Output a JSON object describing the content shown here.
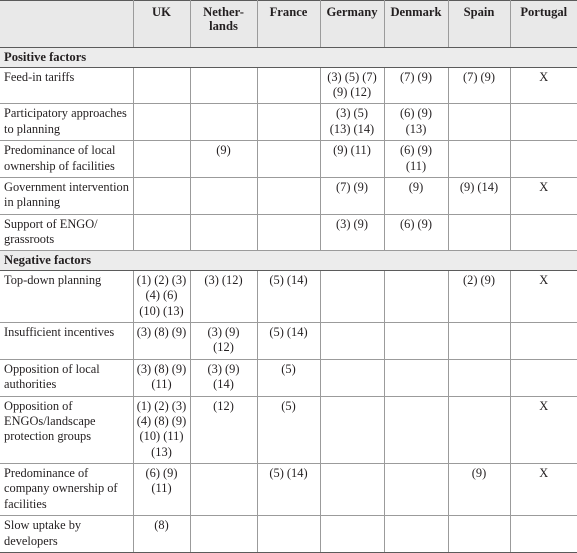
{
  "table": {
    "columns": [
      {
        "key": "factor",
        "label": ""
      },
      {
        "key": "uk",
        "label": "UK"
      },
      {
        "key": "netherlands",
        "label": "Nether-\nlands"
      },
      {
        "key": "france",
        "label": "France"
      },
      {
        "key": "germany",
        "label": "Germany"
      },
      {
        "key": "denmark",
        "label": "Denmark"
      },
      {
        "key": "spain",
        "label": "Spain"
      },
      {
        "key": "portugal",
        "label": "Portugal"
      }
    ],
    "sections": [
      {
        "title": "Positive factors",
        "rows": [
          {
            "factor": "Feed-in tariffs",
            "uk": "",
            "netherlands": "",
            "france": "",
            "germany": "(3) (5) (7)\n(9)  (12)",
            "denmark": "(7) (9)",
            "spain": "(7) (9)",
            "portugal": "X"
          },
          {
            "factor": "Participatory approaches to planning",
            "uk": "",
            "netherlands": "",
            "france": "",
            "germany": "(3) (5)\n(13) (14)",
            "denmark": "(6) (9)\n(13)",
            "spain": "",
            "portugal": ""
          },
          {
            "factor": "Predominance of local ownership of facilities",
            "uk": "",
            "netherlands": "(9)",
            "france": "",
            "germany": "(9) (11)",
            "denmark": "(6) (9)\n(11)",
            "spain": "",
            "portugal": ""
          },
          {
            "factor": "Government intervention in planning",
            "uk": "",
            "netherlands": "",
            "france": "",
            "germany": "(7) (9)",
            "denmark": "(9)",
            "spain": "(9) (14)",
            "portugal": "X"
          },
          {
            "factor": "Support of ENGO/ grassroots",
            "uk": "",
            "netherlands": "",
            "france": "",
            "germany": "(3)  (9)",
            "denmark": "(6) (9)",
            "spain": "",
            "portugal": ""
          }
        ]
      },
      {
        "title": "Negative factors",
        "rows": [
          {
            "factor": "Top-down planning",
            "uk": "(1) (2) (3)\n(4) (6)\n(10) (13)",
            "netherlands": "(3) (12)",
            "france": "(5) (14)",
            "germany": "",
            "denmark": "",
            "spain": "(2) (9)",
            "portugal": "X"
          },
          {
            "factor": "Insufficient incentives",
            "uk": "(3) (8) (9)",
            "netherlands": "(3) (9)\n(12)",
            "france": "(5) (14)",
            "germany": "",
            "denmark": "",
            "spain": "",
            "portugal": ""
          },
          {
            "factor": "Opposition of local authorities",
            "uk": "(3) (8) (9)\n(11)",
            "netherlands": "(3) (9)\n(14)",
            "france": "(5)",
            "germany": "",
            "denmark": "",
            "spain": "",
            "portugal": ""
          },
          {
            "factor": "Opposition of ENGOs/landscape protection groups",
            "uk": "(1) (2) (3)\n(4) (8)  (9)\n(10) (11)\n(13)",
            "netherlands": "(12)",
            "france": "(5)",
            "germany": "",
            "denmark": "",
            "spain": "",
            "portugal": "X"
          },
          {
            "factor": "Predominance of company ownership of facilities",
            "uk": "(6) (9)\n(11)",
            "netherlands": "",
            "france": "(5) (14)",
            "germany": "",
            "denmark": "",
            "spain": "(9)",
            "portugal": "X"
          },
          {
            "factor": "Slow uptake by developers",
            "uk": "(8)",
            "netherlands": "",
            "france": "",
            "germany": "",
            "denmark": "",
            "spain": "",
            "portugal": ""
          }
        ]
      }
    ]
  },
  "style": {
    "header_bg": "#e9e9e9",
    "section_bg": "#ececec",
    "grid_line": "#9b9b9b",
    "rule_line": "#5b5b5b",
    "text_color": "#231f20"
  }
}
